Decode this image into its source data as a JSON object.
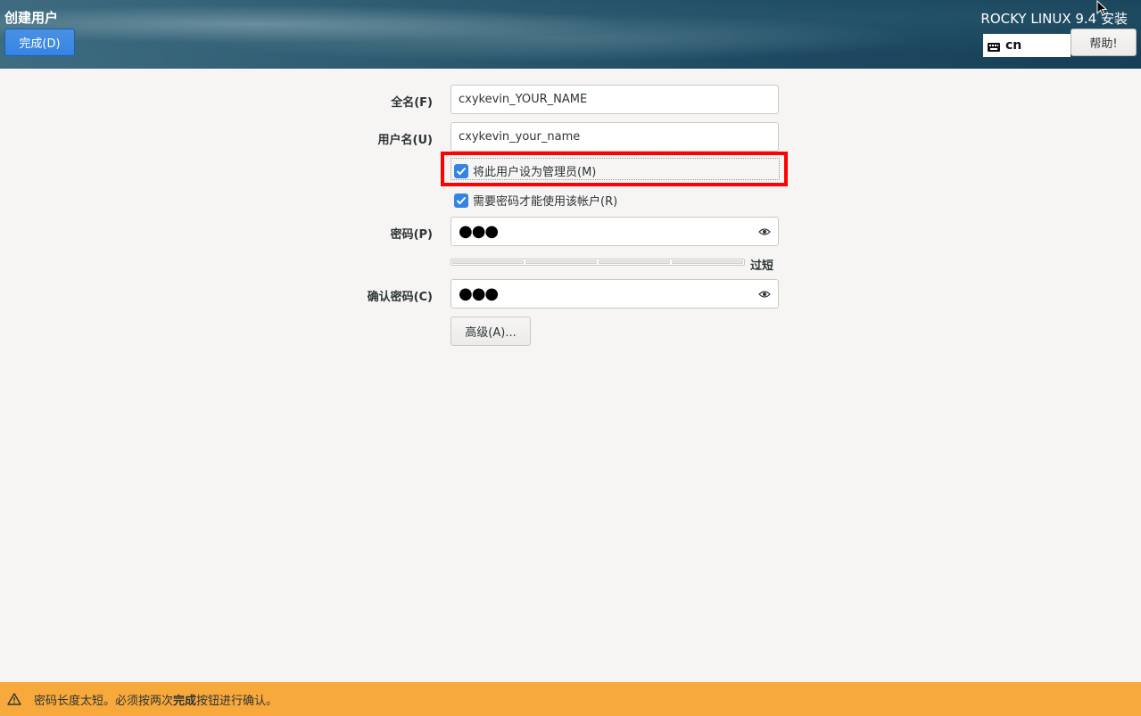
{
  "header": {
    "screen_title": "创建用户",
    "done_label": "完成(D)",
    "product_title": "ROCKY LINUX 9.4 安装",
    "keyboard_layout": "cn",
    "help_label": "帮助!"
  },
  "form": {
    "fullname_label": "全名(F)",
    "fullname_value": "cxykevin_YOUR_NAME",
    "username_label": "用户名(U)",
    "username_value": "cxykevin_your_name",
    "admin_checkbox_label": "将此用户设为管理员(M)",
    "admin_checked": true,
    "require_password_label": "需要密码才能使用该帐户(R)",
    "require_password_checked": true,
    "password_label": "密码(P)",
    "password_value": "●●●",
    "strength_label": "过短",
    "strength_level": 0,
    "confirm_label": "确认密码(C)",
    "confirm_value": "●●●",
    "advanced_label": "高级(A)..."
  },
  "warning": {
    "prefix": "密码长度太短。必须按两次",
    "bold": "完成",
    "suffix": "按钮进行确认。"
  },
  "colors": {
    "accent": "#3584e4",
    "warning_bar": "#f8a93b",
    "highlight_box": "#ff0000"
  }
}
